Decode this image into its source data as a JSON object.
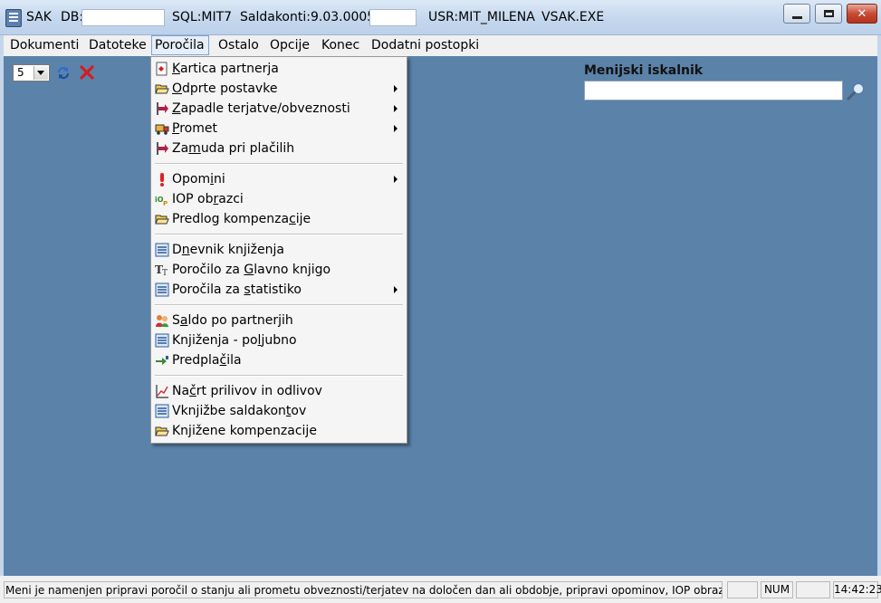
{
  "titlebar": {
    "app": "SAK",
    "db_label": "DB:",
    "sql": "SQL:MIT7",
    "saldakonti": "Saldakonti:9.03.0005",
    "user": "USR:MIT_MILENA",
    "exe": "VSAK.EXE",
    "close_glyph": "✕"
  },
  "menubar": {
    "items": [
      "Dokumenti",
      "Datoteke",
      "Poročila",
      "Ostalo",
      "Opcije",
      "Konec",
      "Dodatni postopki"
    ]
  },
  "toolbar": {
    "select_value": "5"
  },
  "search": {
    "label": "Menijski iskalnik",
    "value": ""
  },
  "dropdown": {
    "items": [
      {
        "pre": "",
        "u": "K",
        "post": "artica partnerja",
        "icon": "card-icon",
        "submenu": false
      },
      {
        "pre": "",
        "u": "O",
        "post": "dprte postavke",
        "icon": "folder-open-icon",
        "submenu": true
      },
      {
        "pre": "",
        "u": "Z",
        "post": "apadle terjatve/obveznosti",
        "icon": "arrow-flag-icon",
        "submenu": true
      },
      {
        "pre": "",
        "u": "P",
        "post": "romet",
        "icon": "truck-icon",
        "submenu": true
      },
      {
        "pre": "Za",
        "u": "m",
        "post": "uda pri plačilih",
        "icon": "arrow-flag-icon",
        "submenu": false
      },
      {
        "pre": "Opom",
        "u": "i",
        "post": "ni",
        "icon": "exclamation-icon",
        "submenu": true
      },
      {
        "pre": "IOP ob",
        "u": "r",
        "post": "azci",
        "icon": "iop-icon",
        "submenu": false
      },
      {
        "pre": "Predlog kompenza",
        "u": "c",
        "post": "ije",
        "icon": "folder-open-icon",
        "submenu": false
      },
      {
        "pre": "D",
        "u": "n",
        "post": "evnik knjiženja",
        "icon": "list-icon",
        "submenu": false
      },
      {
        "pre": "Poročilo za ",
        "u": "G",
        "post": "lavno knjigo",
        "icon": "text-tt-icon",
        "submenu": false
      },
      {
        "pre": "Poročila za ",
        "u": "s",
        "post": "tatistiko",
        "icon": "list-icon",
        "submenu": true
      },
      {
        "pre": "S",
        "u": "a",
        "post": "ldo po partnerjih",
        "icon": "people-icon",
        "submenu": false
      },
      {
        "pre": "Knjiženja - po",
        "u": "l",
        "post": "jubno",
        "icon": "list-icon",
        "submenu": false
      },
      {
        "pre": "Predpla",
        "u": "č",
        "post": "ila",
        "icon": "prepay-icon",
        "submenu": false
      },
      {
        "pre": "Na",
        "u": "č",
        "post": "rt prilivov in odlivov",
        "icon": "chart-icon",
        "submenu": false
      },
      {
        "pre": "Vknjižbe saldakon",
        "u": "t",
        "post": "ov",
        "icon": "list-icon",
        "submenu": false
      },
      {
        "pre": "Knjižene kompenzacije",
        "u": "",
        "post": "",
        "icon": "folder-open-icon",
        "submenu": false
      }
    ]
  },
  "statusbar": {
    "text": "Meni je namenjen pripravi poročil o stanju ali prometu obveznosti/terjatev na določen dan ali obdobje, pripravi opominov, IOP obrazcev",
    "pane1": "",
    "num": "NUM",
    "pane3": "",
    "time": "14:42:23"
  }
}
